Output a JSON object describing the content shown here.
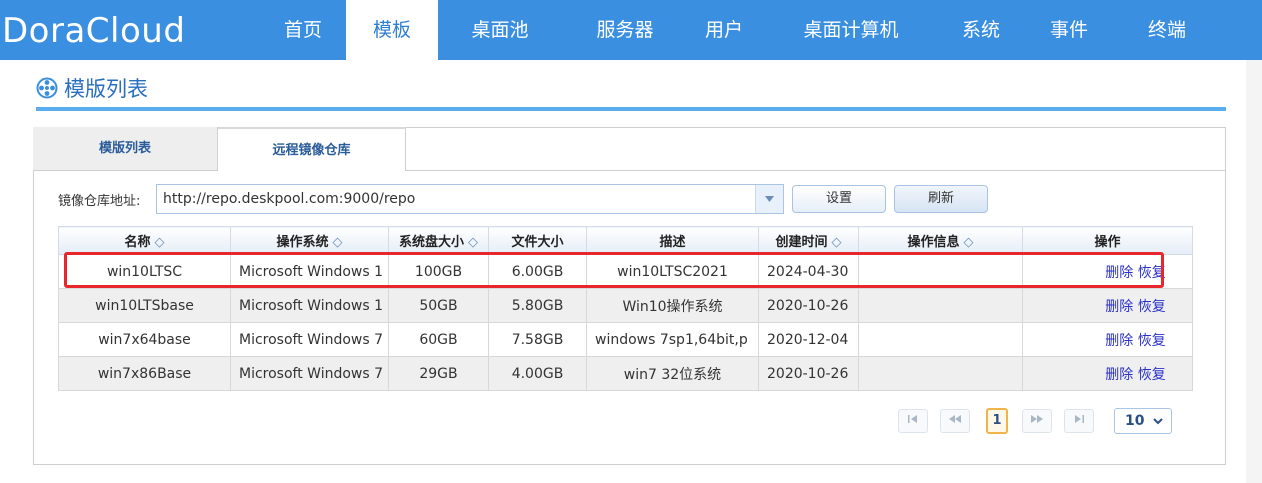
{
  "app": {
    "logo": "DoraCloud"
  },
  "nav": {
    "items": [
      {
        "label": "首页"
      },
      {
        "label": "模板"
      },
      {
        "label": "桌面池"
      },
      {
        "label": "服务器"
      },
      {
        "label": "用户"
      },
      {
        "label": "桌面计算机"
      },
      {
        "label": "系统"
      },
      {
        "label": "事件"
      },
      {
        "label": "终端"
      }
    ],
    "active": "模板"
  },
  "page": {
    "title": "模版列表"
  },
  "tabs": [
    {
      "label": "模版列表"
    },
    {
      "label": "远程镜像仓库"
    }
  ],
  "repo": {
    "label": "镜像仓库地址:",
    "url": "http://repo.deskpool.com:9000/repo",
    "set_button": "设置",
    "refresh_button": "刷新"
  },
  "table": {
    "headers": [
      "名称",
      "操作系统",
      "系统盘大小",
      "文件大小",
      "描述",
      "创建时间",
      "操作信息",
      "操作"
    ],
    "rows": [
      {
        "name": "win10LTSC",
        "os": "Microsoft Windows 1",
        "disk": "100GB",
        "file": "6.00GB",
        "desc": "win10LTSC2021",
        "time": "2024-04-30",
        "info": "",
        "delete": "删除",
        "restore": "恢复"
      },
      {
        "name": "win10LTSbase",
        "os": "Microsoft Windows 1",
        "disk": "50GB",
        "file": "5.80GB",
        "desc": "Win10操作系统",
        "time": "2020-10-26",
        "info": "",
        "delete": "删除",
        "restore": "恢复"
      },
      {
        "name": "win7x64base",
        "os": "Microsoft Windows 7",
        "disk": "60GB",
        "file": "7.58GB",
        "desc": "windows 7sp1,64bit,p",
        "time": "2020-12-04",
        "info": "",
        "delete": "删除",
        "restore": "恢复"
      },
      {
        "name": "win7x86Base",
        "os": "Microsoft Windows 7",
        "disk": "29GB",
        "file": "4.00GB",
        "desc": "win7 32位系统",
        "time": "2020-10-26",
        "info": "",
        "delete": "删除",
        "restore": "恢复"
      }
    ]
  },
  "pager": {
    "current_page": "1",
    "page_size": "10"
  },
  "colors": {
    "nav_bg": "#3a8fe0",
    "highlight": "#e8272d",
    "link": "#2b32c9"
  }
}
